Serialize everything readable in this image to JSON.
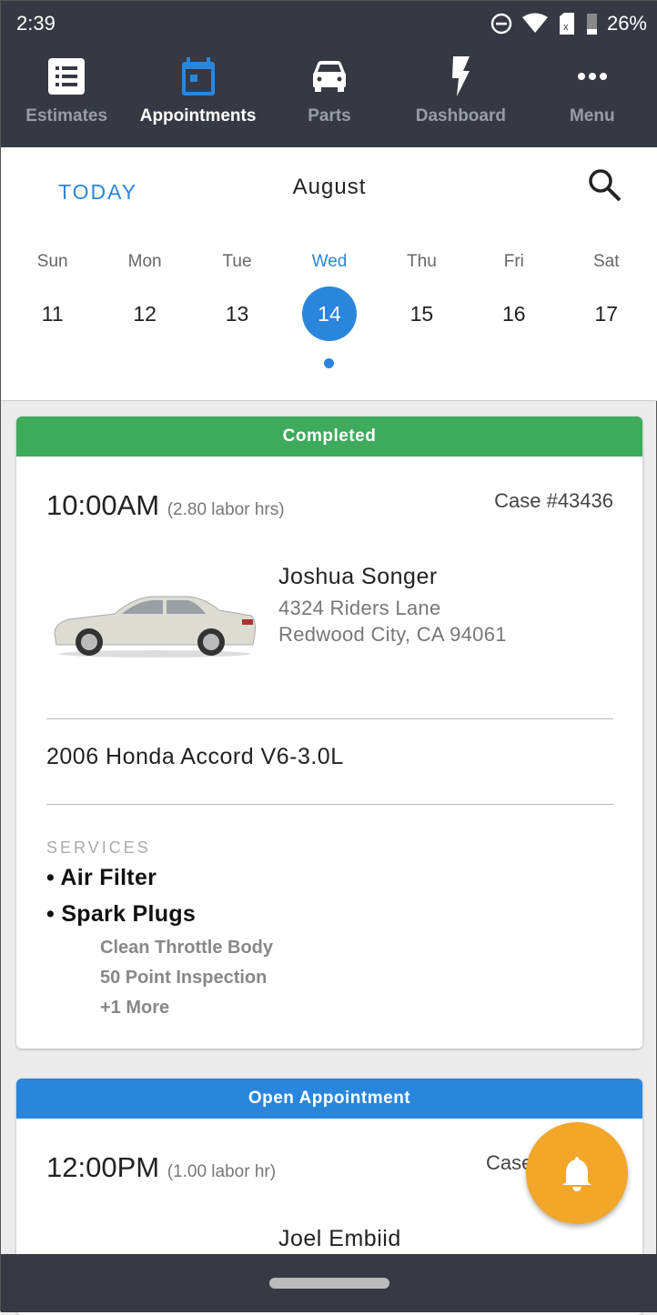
{
  "status": {
    "time": "2:39",
    "battery": "26%"
  },
  "nav": {
    "items": [
      {
        "label": "Estimates",
        "icon": "list-icon"
      },
      {
        "label": "Appointments",
        "icon": "calendar-icon",
        "active": true
      },
      {
        "label": "Parts",
        "icon": "car-icon"
      },
      {
        "label": "Dashboard",
        "icon": "lightning-icon"
      },
      {
        "label": "Menu",
        "icon": "more-icon"
      }
    ]
  },
  "calendar": {
    "today_label": "TODAY",
    "month": "August",
    "days": [
      {
        "name": "Sun",
        "date": "11"
      },
      {
        "name": "Mon",
        "date": "12"
      },
      {
        "name": "Tue",
        "date": "13"
      },
      {
        "name": "Wed",
        "date": "14",
        "selected": true
      },
      {
        "name": "Thu",
        "date": "15"
      },
      {
        "name": "Fri",
        "date": "16"
      },
      {
        "name": "Sat",
        "date": "17"
      }
    ]
  },
  "colors": {
    "accent": "#2a86dc",
    "completed": "#3daa5c",
    "open": "#2a86dc",
    "fab": "#f2a62a",
    "nav_bg": "#363944"
  },
  "appointments": [
    {
      "status": "Completed",
      "time": "10:00AM",
      "labor": "(2.80 labor hrs)",
      "case": "Case #43436",
      "customer": "Joshua Songer",
      "address1": "4324 Riders Lane",
      "address2": "Redwood City, CA 94061",
      "vehicle": "2006 Honda Accord V6-3.0L",
      "services_label": "SERVICES",
      "services": [
        "Air Filter",
        "Spark Plugs"
      ],
      "sub_services": [
        "Clean Throttle Body",
        "50 Point Inspection",
        "+1 More"
      ]
    },
    {
      "status": "Open Appointment",
      "time": "12:00PM",
      "labor": "(1.00 labor hr)",
      "case": "Case",
      "customer": "Joel Embiid"
    }
  ]
}
